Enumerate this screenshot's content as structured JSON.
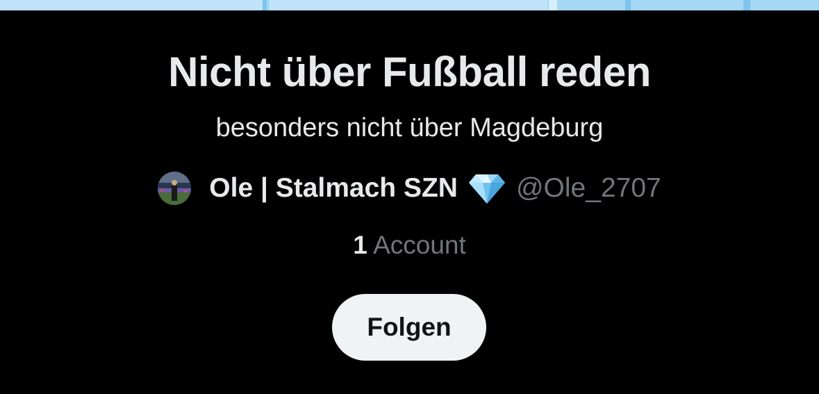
{
  "list": {
    "title": "Nicht über Fußball reden",
    "description": "besonders nicht über Magdeburg"
  },
  "owner": {
    "avatar_icon": "profile-photo-avatar",
    "display_name": "Ole | Stalmach SZN",
    "badge_icon": "gem-emoji-icon",
    "handle": "@Ole_2707"
  },
  "members": {
    "count": "1",
    "label": "Account"
  },
  "actions": {
    "follow_label": "Folgen"
  },
  "colors": {
    "background": "#000000",
    "primary_text": "#e7e9ea",
    "secondary_text": "#71767b",
    "button_bg": "#eff3f4",
    "button_text": "#0f1419",
    "banner": "#a6d8f5"
  }
}
